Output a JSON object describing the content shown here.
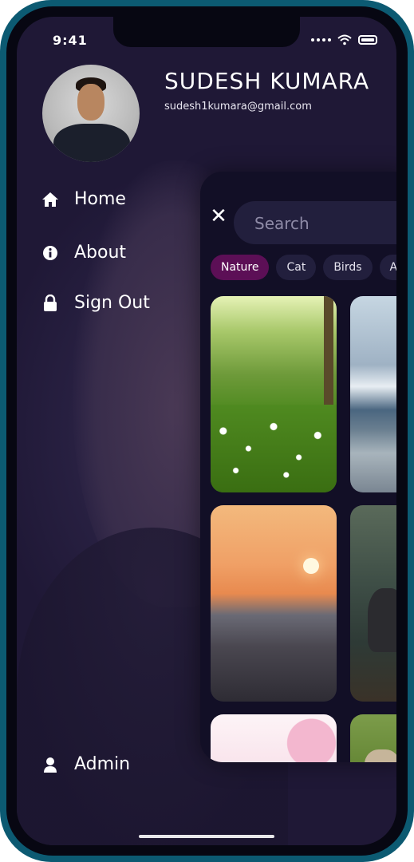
{
  "status_bar": {
    "time": "9:41"
  },
  "profile": {
    "name": "SUDESH KUMARA",
    "email": "sudesh1kumara@gmail.com"
  },
  "menu": {
    "items": [
      {
        "label": "Home",
        "icon": "home-icon"
      },
      {
        "label": "About",
        "icon": "info-icon"
      },
      {
        "label": "Sign Out",
        "icon": "lock-icon"
      }
    ],
    "footer": {
      "label": "Admin",
      "icon": "user-icon"
    }
  },
  "search": {
    "placeholder": "Search",
    "value": ""
  },
  "categories": [
    {
      "label": "Nature",
      "active": true
    },
    {
      "label": "Cat",
      "active": false
    },
    {
      "label": "Birds",
      "active": false
    },
    {
      "label": "Ar",
      "active": false
    }
  ],
  "colors": {
    "accent": "#5c0f56",
    "frame": "#0c5a72",
    "panel": "#120f26",
    "chip": "#221f3d"
  }
}
